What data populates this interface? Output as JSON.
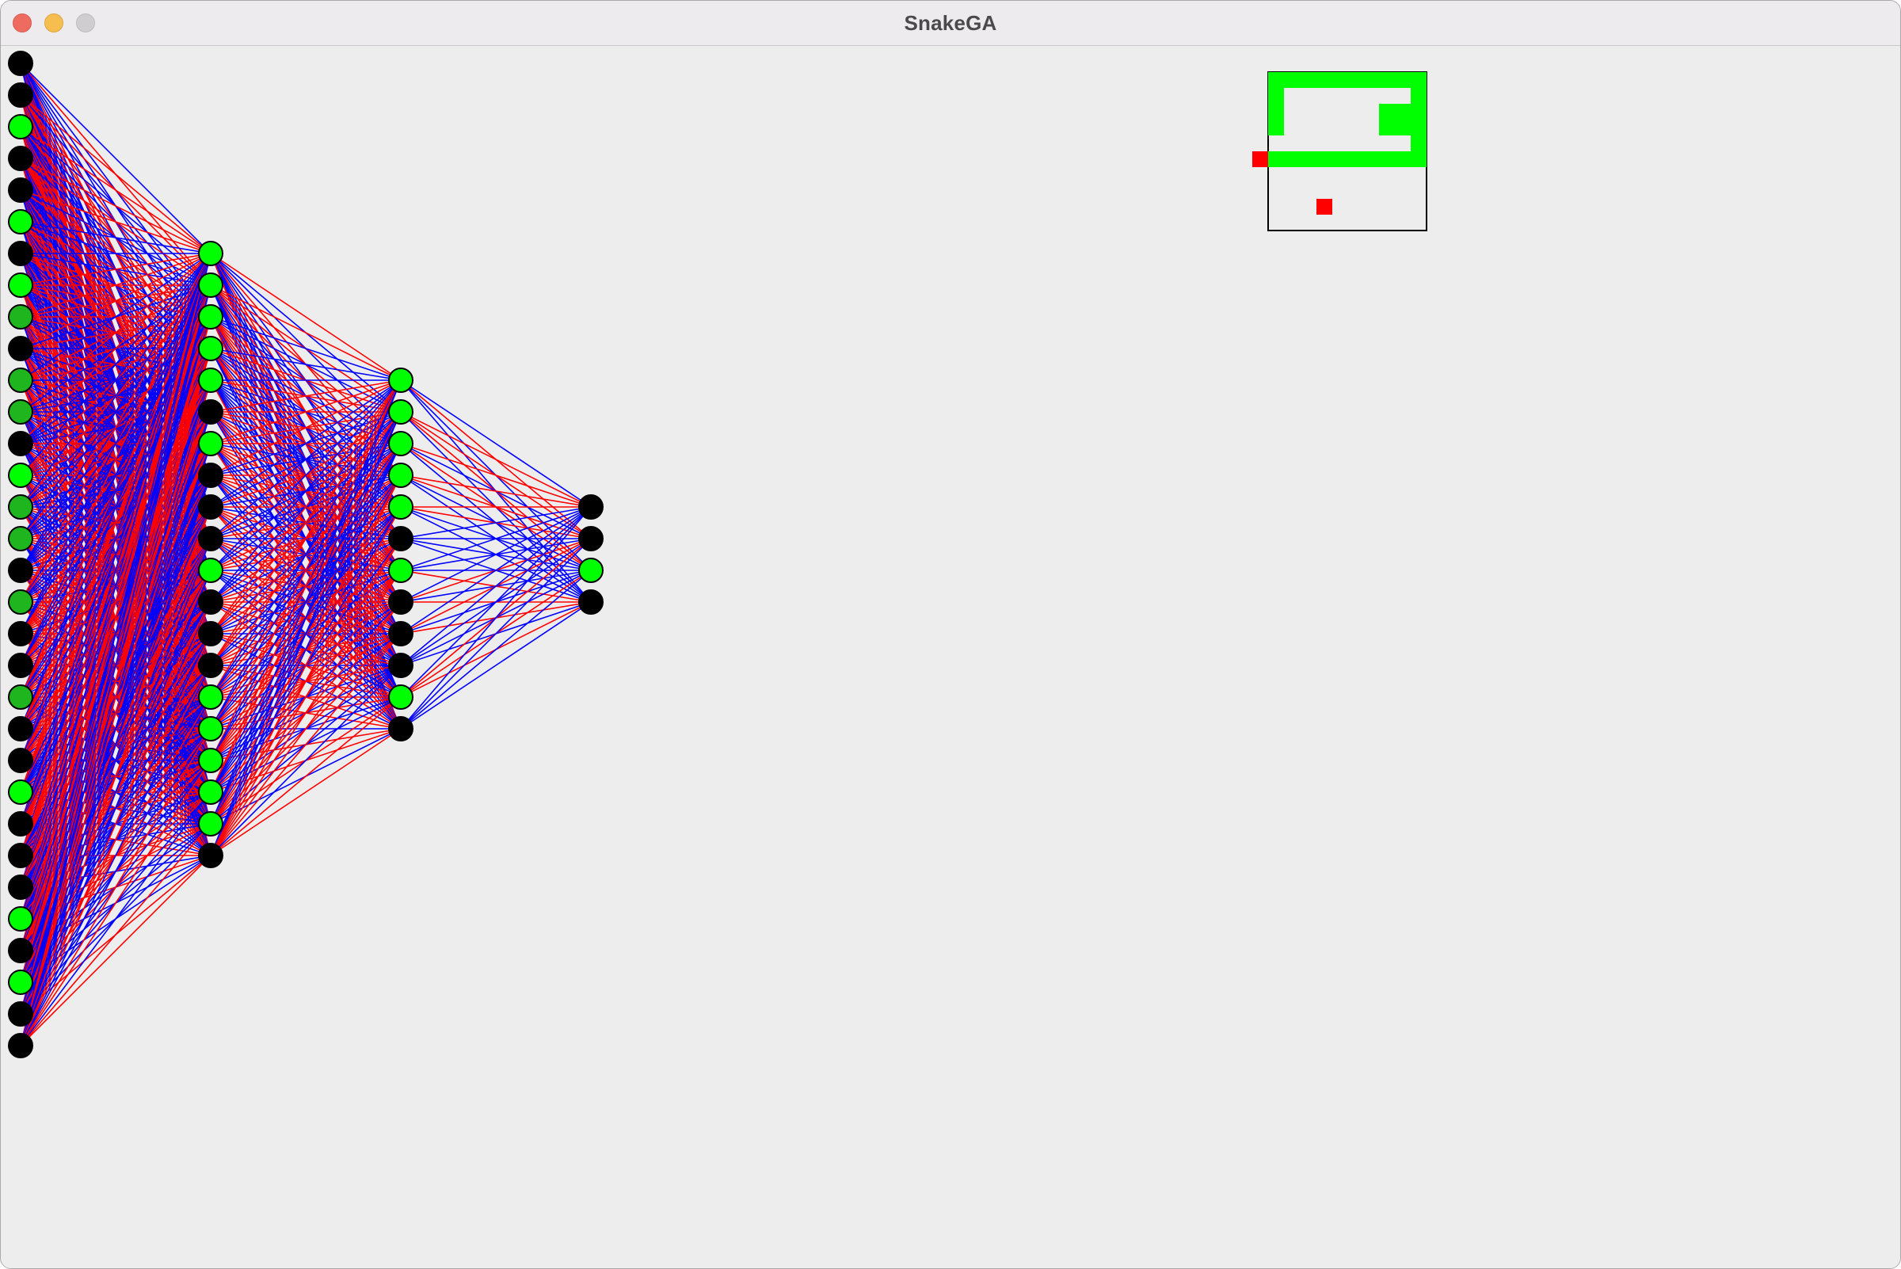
{
  "window": {
    "title": "SnakeGA"
  },
  "network": {
    "layer_sizes": [
      32,
      20,
      12,
      4
    ],
    "activations": [
      [
        "off",
        "off",
        "on",
        "off",
        "off",
        "on",
        "off",
        "on",
        "on-dim",
        "off",
        "on-dim",
        "on-dim",
        "off",
        "on",
        "on-dim",
        "on-dim",
        "off",
        "on-dim",
        "off",
        "off",
        "on-dim",
        "off",
        "off",
        "on",
        "off",
        "off",
        "off",
        "on",
        "off",
        "on",
        "off",
        "off"
      ],
      [
        "on",
        "on",
        "on",
        "on",
        "on",
        "off",
        "on",
        "off",
        "off",
        "off",
        "on",
        "off",
        "off",
        "off",
        "on",
        "on",
        "on",
        "on",
        "on",
        "off"
      ],
      [
        "on",
        "on",
        "on",
        "on",
        "on",
        "off",
        "on",
        "off",
        "off",
        "off",
        "on",
        "off"
      ],
      [
        "off",
        "off",
        "on",
        "off"
      ]
    ],
    "colors": {
      "on": "#00ff00",
      "on-dim": "#1fb51f",
      "off": "#000000",
      "positive_weight": "#ff0000",
      "negative_weight": "#0000ff"
    }
  },
  "game": {
    "colors": {
      "snake": "#00ff00",
      "food": "#ff0000",
      "border": "#000000"
    },
    "board_size": [
      10,
      10
    ]
  }
}
